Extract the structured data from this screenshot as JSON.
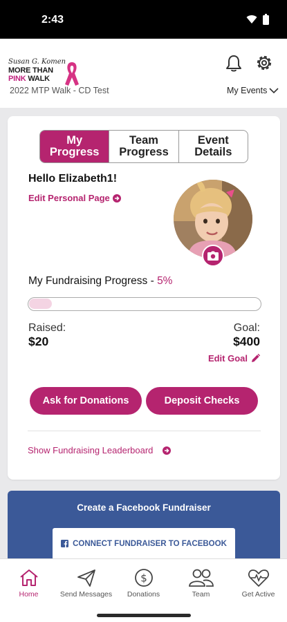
{
  "status_bar": {
    "time": "2:43"
  },
  "header": {
    "logo": {
      "brand": "Susan G. Komen",
      "line1": "MORE THAN",
      "line2_pink": "PINK",
      "line2_dark": "WALK"
    },
    "event_name": "2022 MTP Walk - CD Test",
    "my_events_label": "My Events"
  },
  "tabs": [
    {
      "label": "My Progress",
      "active": true
    },
    {
      "label": "Team Progress",
      "active": false
    },
    {
      "label": "Event Details",
      "active": false
    }
  ],
  "profile": {
    "greeting": "Hello Elizabeth1!",
    "edit_page_label": "Edit Personal Page"
  },
  "fundraising": {
    "title": "My Fundraising Progress - ",
    "percent_label": "5%",
    "progress_fraction": 0.1,
    "raised_label": "Raised:",
    "raised_value": "$20",
    "goal_label": "Goal:",
    "goal_value": "$400",
    "edit_goal_label": "Edit Goal"
  },
  "actions": {
    "ask_donations": "Ask for Donations",
    "deposit_checks": "Deposit Checks",
    "leaderboard_label": "Show Fundraising Leaderboard"
  },
  "facebook": {
    "title": "Create a Facebook Fundraiser",
    "button_label": "CONNECT FUNDRAISER TO FACEBOOK"
  },
  "bottom_nav": [
    {
      "label": "Home",
      "icon": "home-icon",
      "active": true
    },
    {
      "label": "Send Messages",
      "icon": "paper-plane-icon",
      "active": false
    },
    {
      "label": "Donations",
      "icon": "dollar-circle-icon",
      "active": false
    },
    {
      "label": "Team",
      "icon": "team-icon",
      "active": false
    },
    {
      "label": "Get Active",
      "icon": "heartbeat-icon",
      "active": false
    }
  ],
  "colors": {
    "brand_pink": "#b5246f",
    "facebook_blue": "#3b5998",
    "progress_fill": "#f4d4e3"
  }
}
